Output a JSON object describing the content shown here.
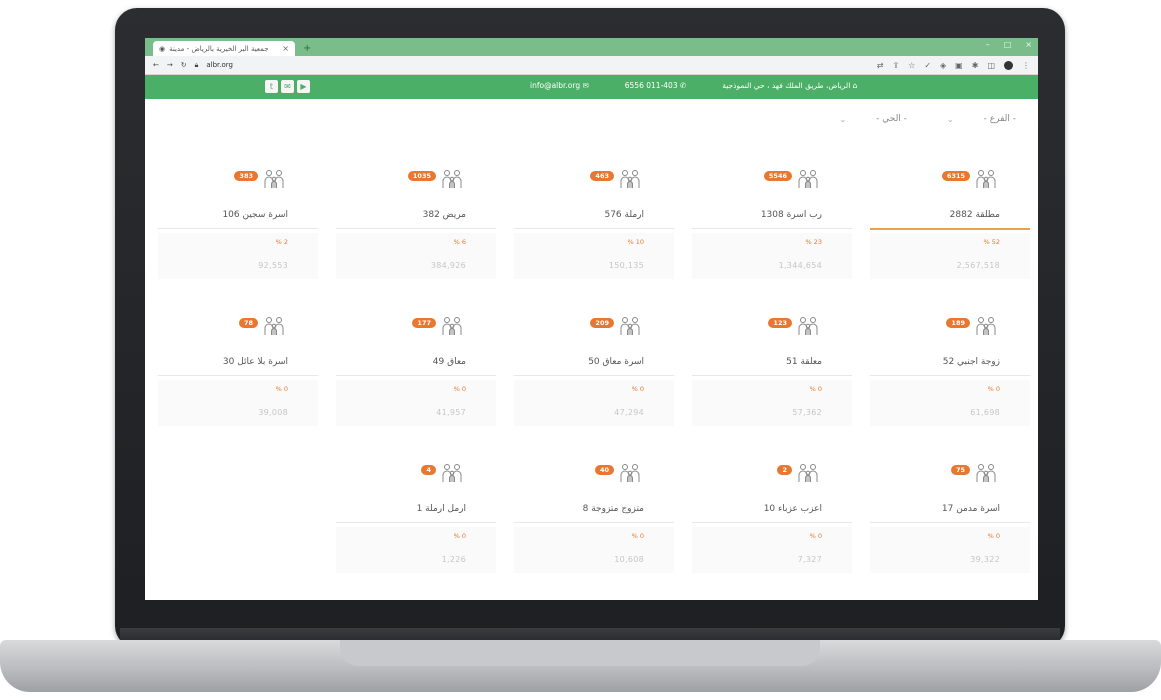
{
  "browser": {
    "tab_title": "جمعية البر الخيرية بالرياض - مدينة",
    "new_tab": "+",
    "url": "albr.org",
    "window_controls": [
      "–",
      "□",
      "×"
    ]
  },
  "site": {
    "social_icons": [
      "twitter-icon",
      "email-icon",
      "youtube-icon"
    ],
    "address": "الرياض، طريق الملك فهد ، حي النموذجية",
    "phone": "011-403 6556",
    "email": "info@albr.org",
    "accent": "#4caf67",
    "badge_color": "#e8782f"
  },
  "filters": [
    {
      "label": "- الفرع -"
    },
    {
      "label": "- الحي -"
    }
  ],
  "cards": [
    {
      "title": "مطلقة 2882",
      "badge": "6315",
      "percent": "% 52",
      "amount": "2,567,518",
      "active": true
    },
    {
      "title": "رب اسرة 1308",
      "badge": "5546",
      "percent": "% 23",
      "amount": "1,344,654",
      "active": false
    },
    {
      "title": "ارملة 576",
      "badge": "463",
      "percent": "% 10",
      "amount": "150,135",
      "active": false
    },
    {
      "title": "مريض 382",
      "badge": "1035",
      "percent": "% 6",
      "amount": "384,926",
      "active": false
    },
    {
      "title": "اسرة سجين 106",
      "badge": "383",
      "percent": "% 2",
      "amount": "92,553",
      "active": false
    },
    {
      "title": "زوجة اجنبي 52",
      "badge": "189",
      "percent": "% 0",
      "amount": "61,698",
      "active": false
    },
    {
      "title": "معلقة 51",
      "badge": "123",
      "percent": "% 0",
      "amount": "57,362",
      "active": false
    },
    {
      "title": "اسرة معاق 50",
      "badge": "209",
      "percent": "% 0",
      "amount": "47,294",
      "active": false
    },
    {
      "title": "معاق 49",
      "badge": "177",
      "percent": "% 0",
      "amount": "41,957",
      "active": false
    },
    {
      "title": "اسرة بلا عائل 30",
      "badge": "78",
      "percent": "% 0",
      "amount": "39,008",
      "active": false
    },
    {
      "title": "اسرة مدمن 17",
      "badge": "75",
      "percent": "% 0",
      "amount": "39,322",
      "active": false
    },
    {
      "title": "اعزب عزباء 10",
      "badge": "2",
      "percent": "% 0",
      "amount": "7,327",
      "active": false
    },
    {
      "title": "متزوج متزوجة 8",
      "badge": "40",
      "percent": "% 0",
      "amount": "10,608",
      "active": false
    },
    {
      "title": "ارمل ارملة 1",
      "badge": "4",
      "percent": "% 0",
      "amount": "1,226",
      "active": false
    }
  ]
}
